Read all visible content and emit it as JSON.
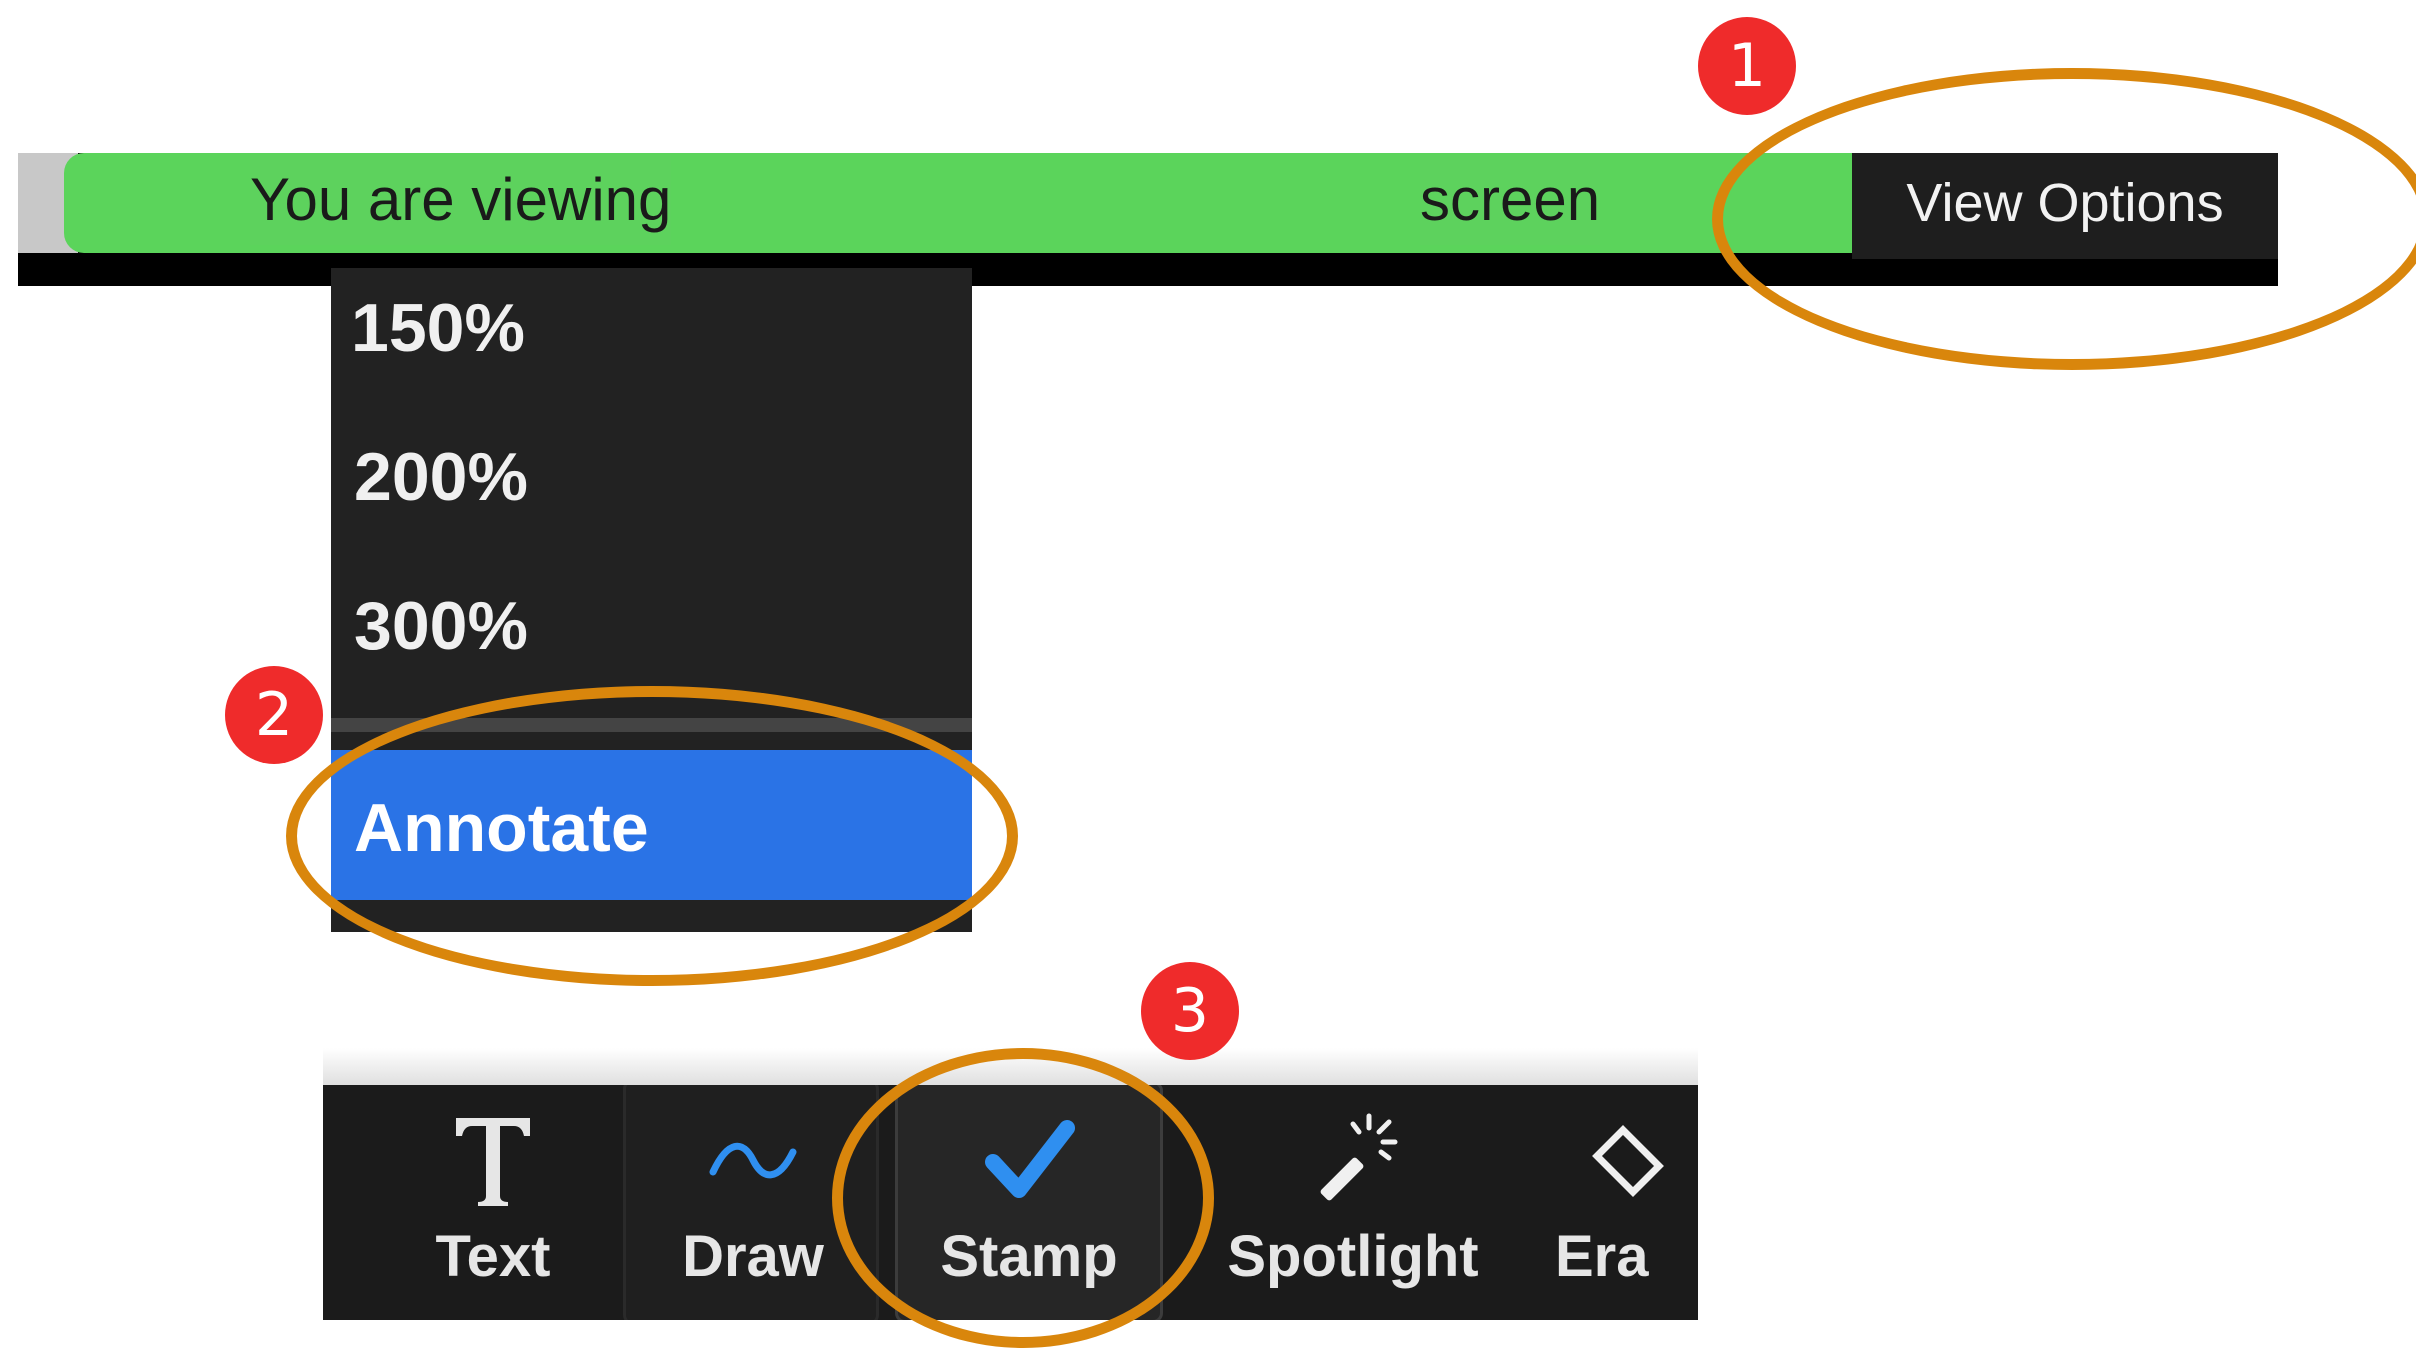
{
  "share_bar": {
    "viewing_label": "You are viewing",
    "screen_label": "screen",
    "view_options_label": "View Options",
    "colors": {
      "green": "#5bd45b",
      "button_bg": "#1e1e1e"
    }
  },
  "view_menu": {
    "items": [
      {
        "label": "150%"
      },
      {
        "label": "200%"
      },
      {
        "label": "300%"
      }
    ],
    "selected_item": {
      "label": "Annotate"
    },
    "colors": {
      "menu_bg": "#222222",
      "selected_bg": "#2a73e6"
    }
  },
  "annotation_toolbar": {
    "tools": [
      {
        "label": "Text",
        "icon": "text-t-icon"
      },
      {
        "label": "Draw",
        "icon": "squiggle-draw-icon"
      },
      {
        "label": "Stamp",
        "icon": "checkmark-stamp-icon",
        "selected": true
      },
      {
        "label": "Spotlight",
        "icon": "magic-wand-spotlight-icon"
      },
      {
        "label": "Era",
        "icon": "eraser-icon"
      }
    ],
    "colors": {
      "toolbar_bg": "#1b1b1b",
      "stamp_check": "#2f8ff0"
    }
  },
  "step_badges": [
    {
      "number": "1"
    },
    {
      "number": "2"
    },
    {
      "number": "3"
    }
  ],
  "highlight_color": "#d9860c",
  "badge_color": "#ef2b2b"
}
